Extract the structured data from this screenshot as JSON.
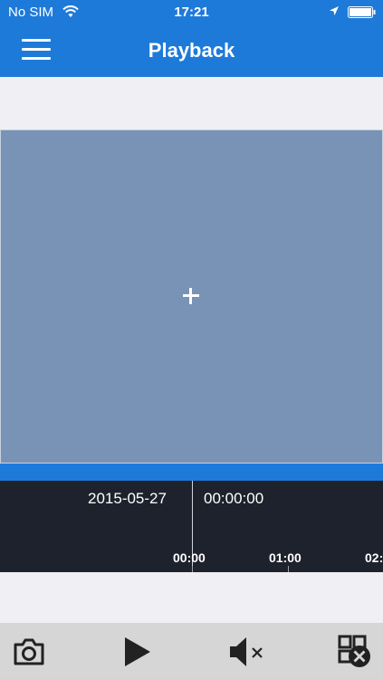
{
  "status_bar": {
    "carrier": "No SIM",
    "time": "17:21",
    "wifi_icon": "wifi-icon",
    "location_icon": "location-arrow-icon",
    "battery_icon": "battery-icon"
  },
  "nav": {
    "title": "Playback",
    "menu_icon": "hamburger-menu-icon"
  },
  "video": {
    "add_icon": "plus-icon"
  },
  "timeline": {
    "date": "2015-05-27",
    "time": "00:00:00",
    "ticks": [
      "00:00",
      "01:00",
      "02:"
    ]
  },
  "toolbar": {
    "items": [
      "camera-icon",
      "play-icon",
      "mute-icon",
      "close-window-icon"
    ]
  },
  "colors": {
    "accent": "#1e7ad9",
    "video_bg": "#7893b6",
    "timeline_bg": "#1d222c",
    "toolbar_bg": "#d6d6d6",
    "page_bg": "#efeff4"
  }
}
